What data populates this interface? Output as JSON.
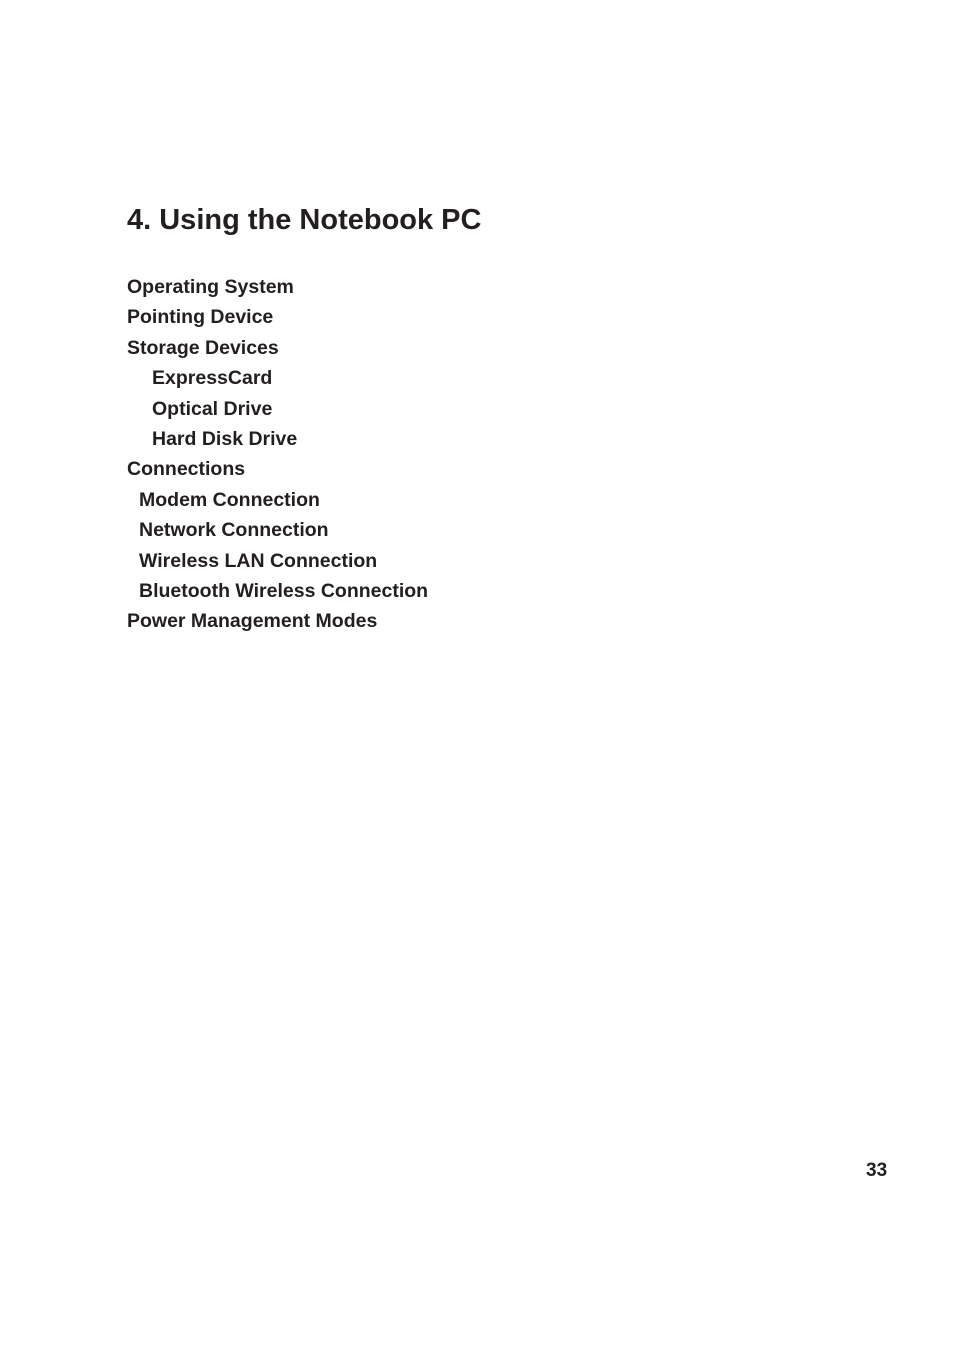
{
  "page": {
    "title": "4. Using the Notebook PC",
    "page_number": "33"
  },
  "toc": [
    {
      "label": "Operating System",
      "level": 1
    },
    {
      "label": "Pointing Device",
      "level": 1
    },
    {
      "label": "Storage Devices",
      "level": 1
    },
    {
      "label": "ExpressCard",
      "level": 2
    },
    {
      "label": "Optical Drive",
      "level": 2
    },
    {
      "label": "Hard Disk Drive",
      "level": 2
    },
    {
      "label": "Connections",
      "level": 1
    },
    {
      "label": "Modem Connection",
      "level": 2
    },
    {
      "label": "Network Connection",
      "level": 2
    },
    {
      "label": "Wireless LAN Connection",
      "level": 2
    },
    {
      "label": "Bluetooth Wireless Connection",
      "level": 2
    },
    {
      "label": "Power Management Modes",
      "level": 1
    }
  ]
}
